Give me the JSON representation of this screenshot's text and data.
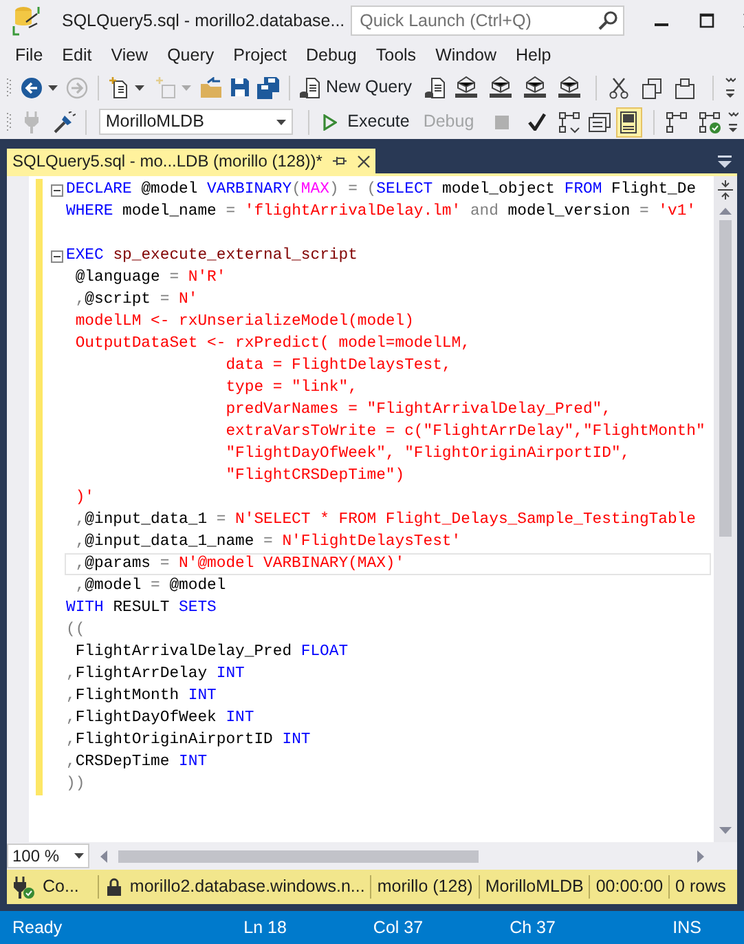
{
  "window": {
    "title": "SQLQuery5.sql - morillo2.database...",
    "quick_launch": {
      "placeholder": "Quick Launch (Ctrl+Q)"
    }
  },
  "menu": [
    "File",
    "Edit",
    "View",
    "Query",
    "Project",
    "Debug",
    "Tools",
    "Window",
    "Help"
  ],
  "toolbar": {
    "new_query": "New Query",
    "database": "MorilloMLDB",
    "execute": "Execute",
    "debug": {
      "label": "Debug",
      "disabled": true
    }
  },
  "document_tab": {
    "title": "SQLQuery5.sql - mo...LDB (morillo (128))*",
    "selected": true
  },
  "editor": {
    "lines": [
      {
        "kind": "block",
        "current": false,
        "tokens": [
          {
            "kind": "kw",
            "text": "DECLARE "
          },
          {
            "kind": "id",
            "text": "@model "
          },
          {
            "kind": "kw",
            "text": "VARBINARY"
          },
          {
            "kind": "op",
            "text": "("
          },
          {
            "kind": "sys",
            "text": "MAX"
          },
          {
            "kind": "op",
            "text": ") = ("
          },
          {
            "kind": "kw",
            "text": "SELECT "
          },
          {
            "kind": "id",
            "text": "model_object "
          },
          {
            "kind": "kw",
            "text": "FROM "
          },
          {
            "kind": "id",
            "text": "Flight_De"
          }
        ]
      },
      {
        "kind": "line",
        "current": false,
        "tokens": [
          {
            "kind": "kw",
            "text": "WHERE "
          },
          {
            "kind": "id",
            "text": "model_name "
          },
          {
            "kind": "op",
            "text": "= "
          },
          {
            "kind": "str",
            "text": "'flightArrivalDelay.lm' "
          },
          {
            "kind": "op",
            "text": "and "
          },
          {
            "kind": "id",
            "text": "model_version "
          },
          {
            "kind": "op",
            "text": "= "
          },
          {
            "kind": "str",
            "text": "'v1'"
          }
        ]
      },
      {
        "kind": "blank"
      },
      {
        "kind": "block",
        "current": false,
        "tokens": [
          {
            "kind": "kw",
            "text": "EXEC "
          },
          {
            "kind": "fn",
            "text": "sp_execute_external_script"
          }
        ]
      },
      {
        "kind": "line",
        "current": false,
        "tokens": [
          {
            "kind": "id",
            "text": " @language "
          },
          {
            "kind": "op",
            "text": "= "
          },
          {
            "kind": "str",
            "text": "N'R'"
          }
        ]
      },
      {
        "kind": "line",
        "current": false,
        "tokens": [
          {
            "kind": "op",
            "text": " ,"
          },
          {
            "kind": "id",
            "text": "@script "
          },
          {
            "kind": "op",
            "text": "= "
          },
          {
            "kind": "str",
            "text": "N'"
          }
        ]
      },
      {
        "kind": "line",
        "current": false,
        "tokens": [
          {
            "kind": "str",
            "text": " modelLM <- rxUnserializeModel(model)"
          }
        ]
      },
      {
        "kind": "line",
        "current": false,
        "tokens": [
          {
            "kind": "str",
            "text": " OutputDataSet <- rxPredict( model=modelLM,"
          }
        ]
      },
      {
        "kind": "line",
        "current": false,
        "tokens": [
          {
            "kind": "str",
            "text": "                 data = FlightDelaysTest,"
          }
        ]
      },
      {
        "kind": "line",
        "current": false,
        "tokens": [
          {
            "kind": "str",
            "text": "                 type = \"link\","
          }
        ]
      },
      {
        "kind": "line",
        "current": false,
        "tokens": [
          {
            "kind": "str",
            "text": "                 predVarNames = \"FlightArrivalDelay_Pred\","
          }
        ]
      },
      {
        "kind": "line",
        "current": false,
        "tokens": [
          {
            "kind": "str",
            "text": "                 extraVarsToWrite = c(\"FlightArrDelay\",\"FlightMonth\""
          }
        ]
      },
      {
        "kind": "line",
        "current": false,
        "tokens": [
          {
            "kind": "str",
            "text": "                 \"FlightDayOfWeek\", \"FlightOriginAirportID\","
          }
        ]
      },
      {
        "kind": "line",
        "current": false,
        "tokens": [
          {
            "kind": "str",
            "text": "                 \"FlightCRSDepTime\")"
          }
        ]
      },
      {
        "kind": "line",
        "current": false,
        "tokens": [
          {
            "kind": "str",
            "text": " )'"
          }
        ]
      },
      {
        "kind": "line",
        "current": false,
        "tokens": [
          {
            "kind": "op",
            "text": " ,"
          },
          {
            "kind": "id",
            "text": "@input_data_1 "
          },
          {
            "kind": "op",
            "text": "= "
          },
          {
            "kind": "str",
            "text": "N'SELECT * FROM Flight_Delays_Sample_TestingTable"
          }
        ]
      },
      {
        "kind": "line",
        "current": false,
        "tokens": [
          {
            "kind": "op",
            "text": " ,"
          },
          {
            "kind": "id",
            "text": "@input_data_1_name "
          },
          {
            "kind": "op",
            "text": "= "
          },
          {
            "kind": "str",
            "text": "N'FlightDelaysTest'"
          }
        ]
      },
      {
        "kind": "line",
        "current": true,
        "tokens": [
          {
            "kind": "op",
            "text": " ,"
          },
          {
            "kind": "id",
            "text": "@params "
          },
          {
            "kind": "op",
            "text": "= "
          },
          {
            "kind": "str",
            "text": "N'@model VARBINARY(MAX)'"
          }
        ]
      },
      {
        "kind": "line",
        "current": false,
        "tokens": [
          {
            "kind": "op",
            "text": " ,"
          },
          {
            "kind": "id",
            "text": "@model "
          },
          {
            "kind": "op",
            "text": "= "
          },
          {
            "kind": "id",
            "text": "@model"
          }
        ]
      },
      {
        "kind": "line",
        "current": false,
        "tokens": [
          {
            "kind": "kw",
            "text": "WITH "
          },
          {
            "kind": "id",
            "text": "RESULT "
          },
          {
            "kind": "kw",
            "text": "SETS"
          }
        ]
      },
      {
        "kind": "line",
        "current": false,
        "tokens": [
          {
            "kind": "op",
            "text": "(("
          }
        ]
      },
      {
        "kind": "line",
        "current": false,
        "tokens": [
          {
            "kind": "id",
            "text": " FlightArrivalDelay_Pred "
          },
          {
            "kind": "kw",
            "text": "FLOAT"
          }
        ]
      },
      {
        "kind": "line",
        "current": false,
        "tokens": [
          {
            "kind": "op",
            "text": ","
          },
          {
            "kind": "id",
            "text": "FlightArrDelay "
          },
          {
            "kind": "kw",
            "text": "INT"
          }
        ]
      },
      {
        "kind": "line",
        "current": false,
        "tokens": [
          {
            "kind": "op",
            "text": ","
          },
          {
            "kind": "id",
            "text": "FlightMonth "
          },
          {
            "kind": "kw",
            "text": "INT"
          }
        ]
      },
      {
        "kind": "line",
        "current": false,
        "tokens": [
          {
            "kind": "op",
            "text": ","
          },
          {
            "kind": "id",
            "text": "FlightDayOfWeek "
          },
          {
            "kind": "kw",
            "text": "INT"
          }
        ]
      },
      {
        "kind": "line",
        "current": false,
        "tokens": [
          {
            "kind": "op",
            "text": ","
          },
          {
            "kind": "id",
            "text": "FlightOriginAirportID "
          },
          {
            "kind": "kw",
            "text": "INT"
          }
        ]
      },
      {
        "kind": "line",
        "current": false,
        "tokens": [
          {
            "kind": "op",
            "text": ","
          },
          {
            "kind": "id",
            "text": "CRSDepTime "
          },
          {
            "kind": "kw",
            "text": "INT"
          }
        ]
      },
      {
        "kind": "line",
        "current": false,
        "tokens": [
          {
            "kind": "op",
            "text": "))"
          }
        ]
      }
    ]
  },
  "zoom": "100 %",
  "query_status": {
    "connection": "Co...",
    "server": "morillo2.database.windows.n...",
    "user": "morillo (128)",
    "database": "MorilloMLDB",
    "elapsed": "00:00:00",
    "rows": "0 rows"
  },
  "status_bar": {
    "state": "Ready",
    "line": "Ln 18",
    "column": "Col 37",
    "char": "Ch 37",
    "mode": "INS"
  }
}
